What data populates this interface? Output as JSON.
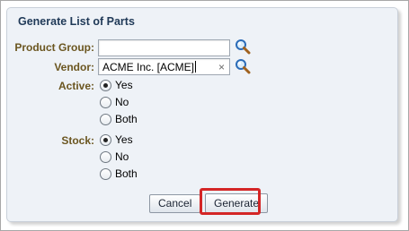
{
  "dialog": {
    "title": "Generate List of Parts"
  },
  "form": {
    "product_group": {
      "label": "Product Group:",
      "value": ""
    },
    "vendor": {
      "label": "Vendor:",
      "value": "ACME Inc. [ACME]",
      "clear_glyph": "×"
    },
    "active": {
      "label": "Active:",
      "options": [
        "Yes",
        "No",
        "Both"
      ],
      "selected": "Yes"
    },
    "stock": {
      "label": "Stock:",
      "options": [
        "Yes",
        "No",
        "Both"
      ],
      "selected": "Yes"
    }
  },
  "buttons": {
    "cancel": "Cancel",
    "generate": "Generate"
  },
  "colors": {
    "title": "#1f3957",
    "label": "#6b5620",
    "dialog_bg": "#eef2f7",
    "highlight": "#d42626"
  },
  "icons": {
    "search": "magnifier-icon"
  }
}
